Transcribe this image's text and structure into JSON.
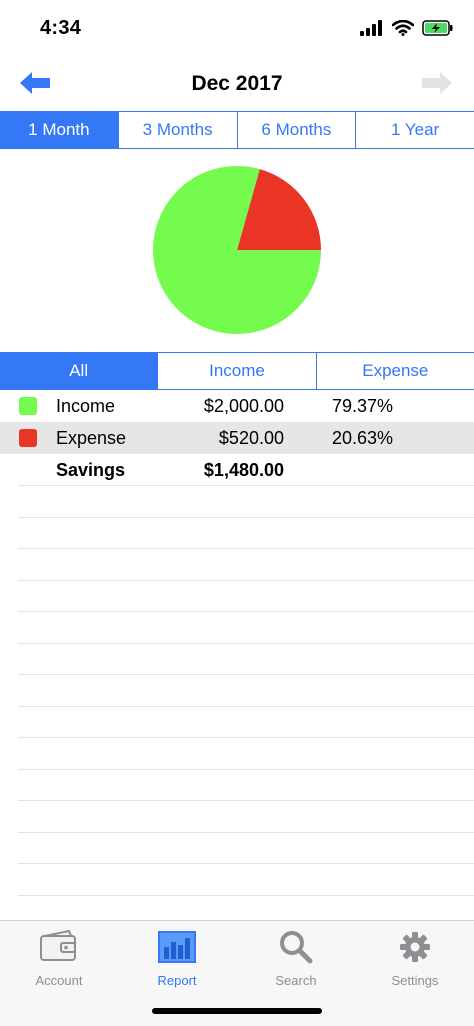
{
  "status": {
    "time": "4:34"
  },
  "nav": {
    "title": "Dec 2017",
    "back_icon": "arrow-left-icon",
    "forward_icon": "arrow-right-icon"
  },
  "range_tabs": [
    {
      "label": "1 Month",
      "active": true
    },
    {
      "label": "3 Months",
      "active": false
    },
    {
      "label": "6 Months",
      "active": false
    },
    {
      "label": "1 Year",
      "active": false
    }
  ],
  "type_tabs": [
    {
      "label": "All",
      "active": true
    },
    {
      "label": "Income",
      "active": false
    },
    {
      "label": "Expense",
      "active": false
    }
  ],
  "chart_data": {
    "type": "pie",
    "categories": [
      "Income",
      "Expense"
    ],
    "values": [
      79.37,
      20.63
    ],
    "colors": [
      "#74fb4d",
      "#e93426"
    ]
  },
  "summary": {
    "rows": [
      {
        "label": "Income",
        "amount": "$2,000.00",
        "percent": "79.37%",
        "color": "#74fb4d"
      },
      {
        "label": "Expense",
        "amount": "$520.00",
        "percent": "20.63%",
        "color": "#e93426"
      }
    ],
    "savings": {
      "label": "Savings",
      "amount": "$1,480.00"
    }
  },
  "tab_bar": [
    {
      "label": "Account",
      "icon": "wallet-icon",
      "active": false
    },
    {
      "label": "Report",
      "icon": "bar-chart-icon",
      "active": true
    },
    {
      "label": "Search",
      "icon": "magnifier-icon",
      "active": false
    },
    {
      "label": "Settings",
      "icon": "gear-icon",
      "active": false
    }
  ],
  "colors": {
    "accent": "#3478f6",
    "income": "#74fb4d",
    "expense": "#e93426"
  }
}
